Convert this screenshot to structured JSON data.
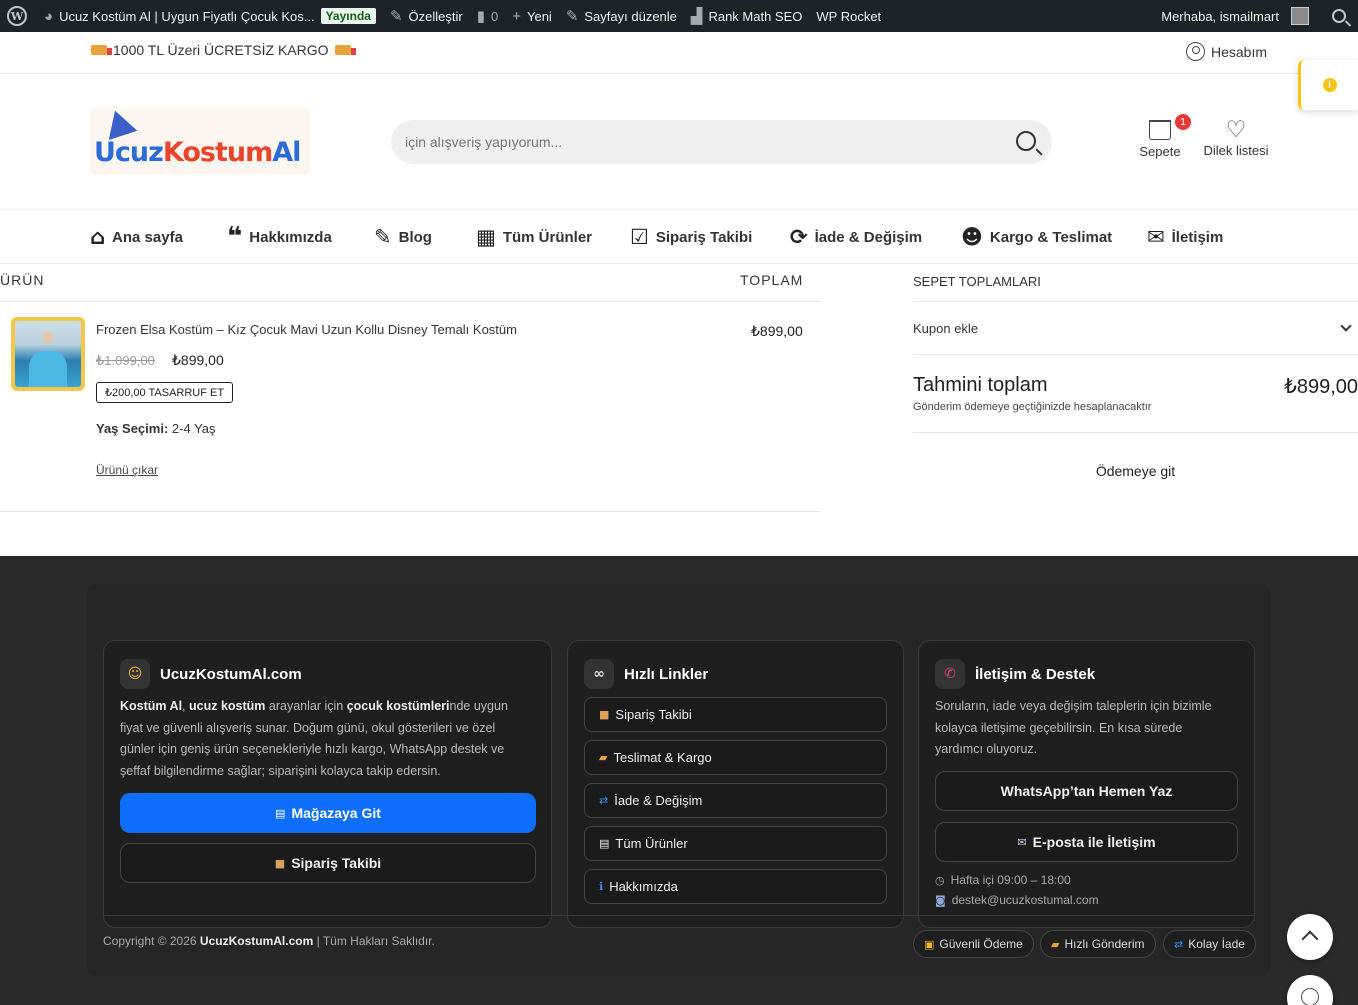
{
  "adminbar": {
    "site_title": "Ucuz Kostüm Al | Uygun Fiyatlı Çocuk Kos...",
    "live_badge": "Yayında",
    "customize": "Özelleştir",
    "comments_count": "0",
    "new": "Yeni",
    "edit_page": "Sayfayı düzenle",
    "rank_math": "Rank Math SEO",
    "wp_rocket": "WP Rocket",
    "greeting": "Merhaba, ismailmart"
  },
  "topstrip": {
    "promo": "1000 TL Üzeri ÜCRETSİZ KARGO",
    "account": "Hesabım"
  },
  "header": {
    "logo_text": "UcuzKostumAl",
    "search_placeholder": "için alışveriş yapıyorum...",
    "cart_label": "Sepete",
    "cart_count": "1",
    "wishlist_label": "Dilek listesi"
  },
  "nav": {
    "items": [
      {
        "label": "Ana sayfa",
        "icon": "home-icon"
      },
      {
        "label": "Hakkımızda",
        "icon": "quote-icon"
      },
      {
        "label": "Blog",
        "icon": "edit-icon"
      },
      {
        "label": "Tüm Ürünler",
        "icon": "grid-icon"
      },
      {
        "label": "Sipariş Takibi",
        "icon": "checkbox-icon"
      },
      {
        "label": "İade & Değişim",
        "icon": "refresh-icon"
      },
      {
        "label": "Kargo & Teslimat",
        "icon": "users-icon"
      },
      {
        "label": "İletişim",
        "icon": "envelope-icon"
      }
    ]
  },
  "cart": {
    "col_product": "ÜRÜN",
    "col_total": "TOPLAM",
    "item": {
      "name": "Frozen Elsa Kostüm – Kız Çocuk Mavi Uzun Kollu Disney Temalı Kostüm",
      "old_price": "₺1.099,00",
      "price": "₺899,00",
      "save": "₺200,00 TASARRUF ET",
      "variant_label": "Yaş Seçimi:",
      "variant_value": "2-4 Yaş",
      "remove": "Ürünü çıkar",
      "total": "₺899,00"
    }
  },
  "totals": {
    "title": "SEPET TOPLAMLARI",
    "coupon": "Kupon ekle",
    "estimate_label": "Tahmini toplam",
    "estimate_value": "₺899,00",
    "shipping_note": "Gönderim ödemeye geçtiğinizde hesaplanacaktır",
    "checkout": "Ödemeye git"
  },
  "footer": {
    "about": {
      "title": "UcuzKostumAl.com",
      "p1_b1": "Kostüm Al",
      "p1_t1": ", ",
      "p1_b2": "ucuz kostüm",
      "p1_t2": " arayanlar için ",
      "p1_b3": "çocuk kostümleri",
      "p1_t3": "nde uygun",
      "line2": "fiyat ve güvenli alışveriş sunar. Doğum günü, okul gösterileri ve özel",
      "line3": "günler için geniş ürün seçenekleriyle hızlı kargo, WhatsApp destek ve",
      "line4": "şeffaf bilgilendirme sağlar; siparişini kolayca takip edersin.",
      "btn_store": "Mağazaya Git",
      "btn_track": "Sipariş Takibi"
    },
    "links": {
      "title": "Hızlı Linkler",
      "items": [
        "Sipariş Takibi",
        "Teslimat & Kargo",
        "İade & Değişim",
        "Tüm Ürünler",
        "Hakkımızda"
      ]
    },
    "contact": {
      "title": "İletişim & Destek",
      "line1": "Soruların, iade veya değişim taleplerin için bizimle",
      "line2": "kolayca iletişime geçebilirsin. En kısa sürede",
      "line3": "yardımcı oluyoruz.",
      "whatsapp": "WhatsApp’tan Hemen Yaz",
      "email_btn": "E-posta ile İletişim",
      "hours": "Hafta içi 09:00 – 18:00",
      "email": "destek@ucuzkostumal.com"
    },
    "copyright_prefix": "Copyright © 2026 ",
    "copyright_brand": "UcuzKostumAl.com",
    "copyright_suffix": " | Tüm Hakları Saklıdır.",
    "chips": [
      "Güvenli Ödeme",
      "Hızlı Gönderim",
      "Kolay İade"
    ]
  }
}
